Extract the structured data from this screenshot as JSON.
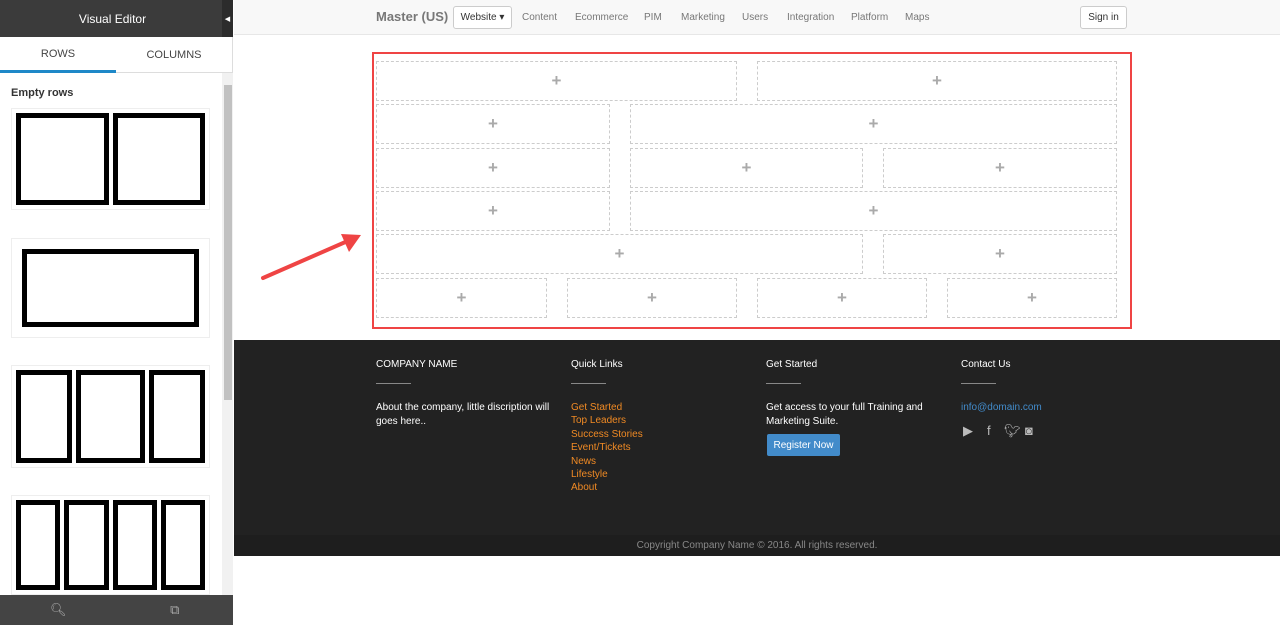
{
  "sidebar": {
    "title": "Visual Editor",
    "tabs": [
      {
        "label": "ROWS",
        "active": true
      },
      {
        "label": "COLUMNS",
        "active": false
      }
    ],
    "section_title": "Empty rows",
    "footer_icons": [
      "search-icon",
      "sitemap-icon"
    ]
  },
  "navbar": {
    "brand": "Master (US)",
    "dropdown": "Website ▾",
    "links": [
      "Content",
      "Ecommerce",
      "PIM",
      "Marketing",
      "Users",
      "Integration",
      "Platform",
      "Maps"
    ],
    "signin": "Sign in"
  },
  "grid": {
    "plus": "+",
    "highlight_color": "#ef4444"
  },
  "footer": {
    "col1": {
      "title": "COMPANY NAME",
      "text": "About the company, little discription will goes here.."
    },
    "col2": {
      "title": "Quick Links",
      "links": [
        "Get Started",
        "Top Leaders",
        "Success Stories",
        "Event/Tickets",
        "News",
        "Lifestyle",
        "About"
      ]
    },
    "col3": {
      "title": "Get Started",
      "text": "Get access to your full Training and Marketing Suite.",
      "button": "Register Now"
    },
    "col4": {
      "title": "Contact Us",
      "email": "info@domain.com",
      "social": [
        "youtube-icon",
        "facebook-icon",
        "twitter-icon",
        "instagram-icon"
      ]
    },
    "copyright": "Copyright Company Name © 2016. All rights reserved."
  }
}
